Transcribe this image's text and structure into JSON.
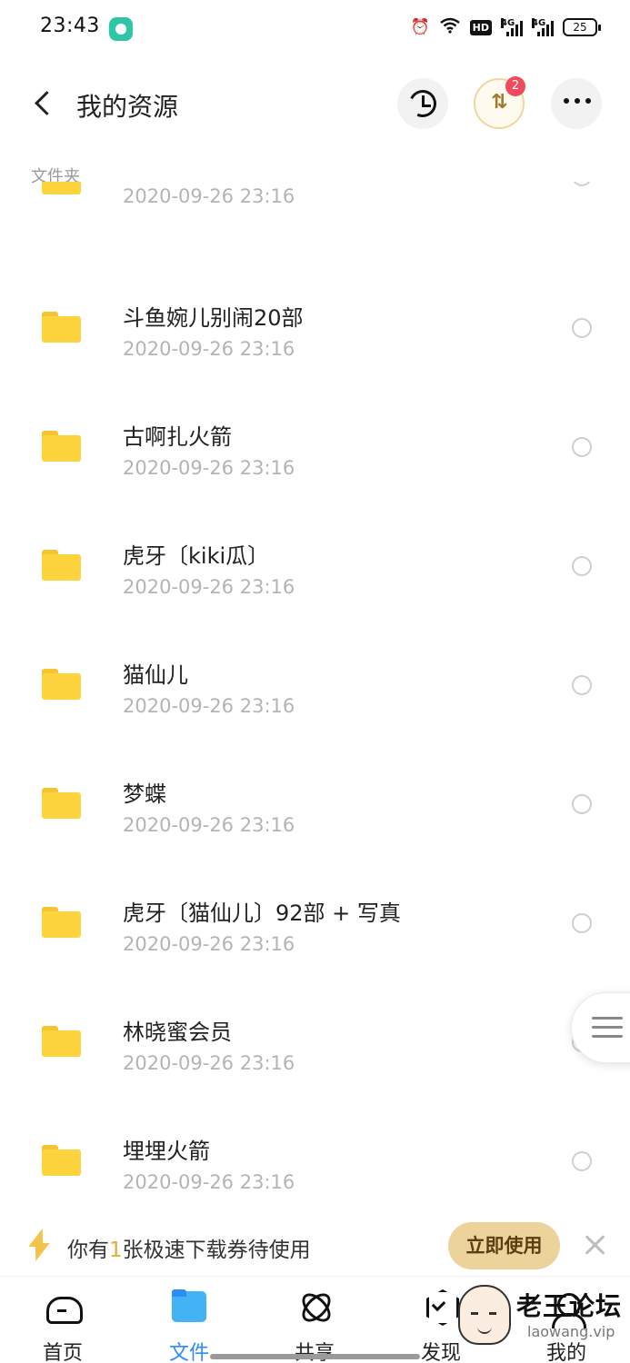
{
  "status_bar": {
    "time": "23:43",
    "hd_label": "HD",
    "network_1": "4G",
    "network_2": "4G",
    "battery": "25"
  },
  "header": {
    "title": "我的资源",
    "transfer_badge": "2"
  },
  "section_label": "文件夹",
  "files": [
    {
      "name": "",
      "date": "2020-09-26  23:16"
    },
    {
      "name": "斗鱼婉儿别闹20部",
      "date": "2020-09-26  23:16"
    },
    {
      "name": "古啊扎火箭",
      "date": "2020-09-26  23:16"
    },
    {
      "name": "虎牙〔kiki瓜〕",
      "date": "2020-09-26  23:16"
    },
    {
      "name": "猫仙儿",
      "date": "2020-09-26  23:16"
    },
    {
      "name": "梦蝶",
      "date": "2020-09-26  23:16"
    },
    {
      "name": "虎牙〔猫仙儿〕92部 + 写真",
      "date": "2020-09-26  23:16"
    },
    {
      "name": "林晓蜜会员",
      "date": "2020-09-26  23:16"
    },
    {
      "name": "埋埋火箭",
      "date": "2020-09-26  23:16"
    }
  ],
  "promo": {
    "text_before": "你有",
    "count": "1",
    "text_after": "张极速下载券待使用",
    "button_label": "立即使用"
  },
  "bottom_nav": [
    {
      "label": "首页",
      "icon": "cloud-icon",
      "active": false
    },
    {
      "label": "文件",
      "icon": "file-folder-icon",
      "active": true
    },
    {
      "label": "共享",
      "icon": "share-orbit-icon",
      "active": false
    },
    {
      "label": "发现",
      "icon": "discover-icon",
      "active": false
    },
    {
      "label": "我的",
      "icon": "profile-icon",
      "active": false
    }
  ],
  "watermark": {
    "title": "老王论坛",
    "url": "laowang.vip"
  },
  "colors": {
    "accent_blue": "#2d8cf5",
    "folder_yellow": "#fdd43e",
    "badge_red": "#f04b5c",
    "promo_gold": "#ecd39b"
  }
}
